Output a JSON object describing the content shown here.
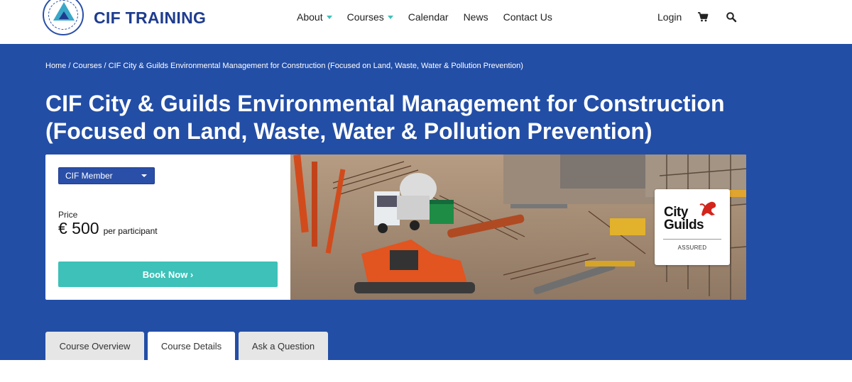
{
  "brand": {
    "name": "CIF TRAINING",
    "logo": "cif-logo"
  },
  "nav": {
    "items": [
      {
        "label": "About",
        "has_dropdown": true
      },
      {
        "label": "Courses",
        "has_dropdown": true
      },
      {
        "label": "Calendar",
        "has_dropdown": false
      },
      {
        "label": "News",
        "has_dropdown": false
      },
      {
        "label": "Contact Us",
        "has_dropdown": false
      }
    ],
    "login": "Login",
    "cart_icon": "cart-icon",
    "search_icon": "search-icon",
    "accent": "#3cc1b7"
  },
  "breadcrumb": {
    "home": "Home",
    "courses": "Courses",
    "current": "CIF City & Guilds Environmental Management for Construction (Focused on Land, Waste, Water & Pollution Prevention)",
    "separator": " / "
  },
  "page_title": "CIF City & Guilds Environmental Management for Construction (Focused on Land, Waste, Water & Pollution Prevention)",
  "pricing": {
    "member_select": "CIF Member",
    "price_label": "Price",
    "price": "€ 500",
    "price_unit": "per participant",
    "book_label": "Book Now ›"
  },
  "badge": {
    "line1": "City",
    "line2": "Guilds",
    "assured": "ASSURED"
  },
  "tabs": [
    {
      "label": "Course Overview",
      "active": false
    },
    {
      "label": "Course Details",
      "active": true
    },
    {
      "label": "Ask a Question",
      "active": false
    }
  ],
  "colors": {
    "hero_bg": "#234ea6",
    "brand_blue": "#1e3c8f",
    "book_button": "#3dc1b8"
  }
}
